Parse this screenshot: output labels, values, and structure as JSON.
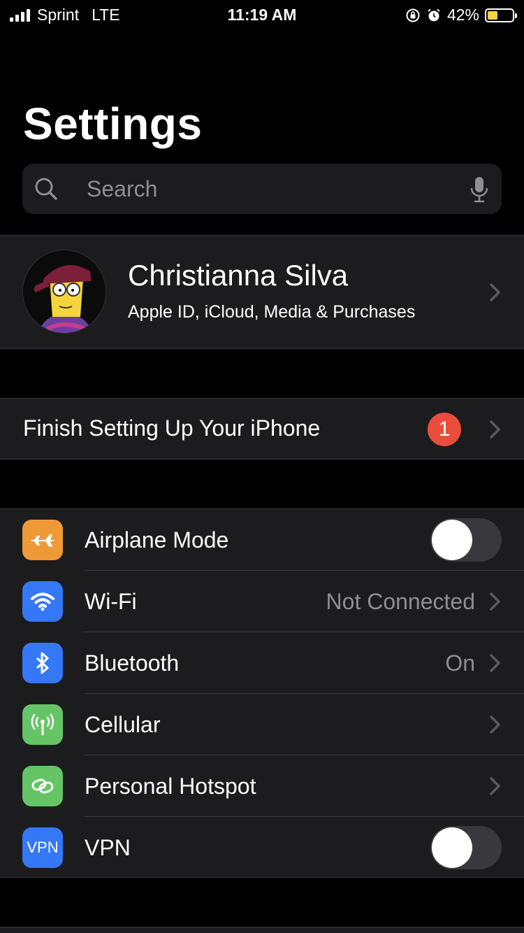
{
  "status_bar": {
    "carrier": "Sprint",
    "network": "LTE",
    "time": "11:19 AM",
    "battery_percent": "42%",
    "battery_level": 0.42
  },
  "page": {
    "title": "Settings"
  },
  "search": {
    "placeholder": "Search"
  },
  "profile": {
    "name": "Christianna Silva",
    "subtitle": "Apple ID, iCloud, Media & Purchases"
  },
  "finish_setup": {
    "label": "Finish Setting Up Your iPhone",
    "badge_count": "1"
  },
  "connectivity": {
    "airplane": {
      "label": "Airplane Mode",
      "enabled": false,
      "icon": "airplane-icon",
      "color": "#f09a37"
    },
    "wifi": {
      "label": "Wi-Fi",
      "value": "Not Connected",
      "icon": "wifi-icon",
      "color": "#3478f6"
    },
    "bluetooth": {
      "label": "Bluetooth",
      "value": "On",
      "icon": "bluetooth-icon",
      "color": "#3478f6"
    },
    "cellular": {
      "label": "Cellular",
      "icon": "antenna-icon",
      "color": "#65c466"
    },
    "hotspot": {
      "label": "Personal Hotspot",
      "icon": "hotspot-icon",
      "color": "#65c466"
    },
    "vpn": {
      "label": "VPN",
      "icon_text": "VPN",
      "enabled": false,
      "color": "#3478f6"
    }
  }
}
